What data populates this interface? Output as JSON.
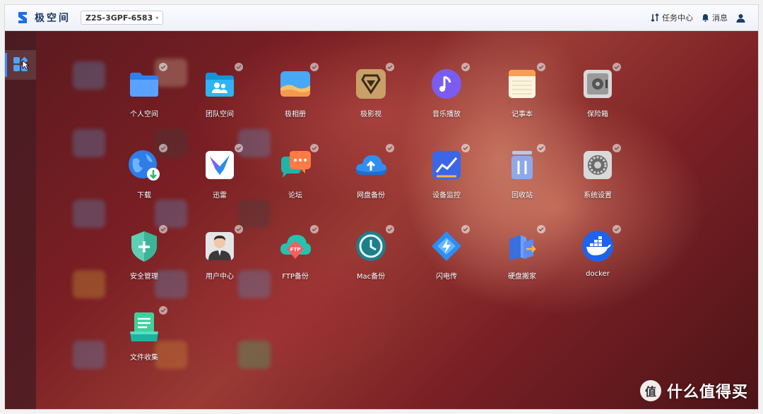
{
  "topbar": {
    "brand": "极空间",
    "device_name": "Z2S-3GPF-6583",
    "task_center": "任务中心",
    "messages": "消息",
    "icons": {
      "task": "task-center-icon",
      "bell": "bell-icon",
      "user": "user-icon"
    }
  },
  "apps": [
    {
      "label": "个人空间",
      "icon": "folder-icon"
    },
    {
      "label": "团队空间",
      "icon": "team-folder-icon"
    },
    {
      "label": "极相册",
      "icon": "photo-album-icon"
    },
    {
      "label": "极影视",
      "icon": "video-icon"
    },
    {
      "label": "音乐播放",
      "icon": "music-icon"
    },
    {
      "label": "记事本",
      "icon": "notepad-icon"
    },
    {
      "label": "保险箱",
      "icon": "safe-icon"
    },
    {
      "label": "下载",
      "icon": "download-globe-icon"
    },
    {
      "label": "迅雷",
      "icon": "thunder-icon"
    },
    {
      "label": "论坛",
      "icon": "forum-icon"
    },
    {
      "label": "网盘备份",
      "icon": "cloud-backup-icon"
    },
    {
      "label": "设备监控",
      "icon": "monitor-chart-icon"
    },
    {
      "label": "回收站",
      "icon": "trash-icon"
    },
    {
      "label": "系统设置",
      "icon": "settings-icon"
    },
    {
      "label": "安全管理",
      "icon": "shield-icon"
    },
    {
      "label": "用户中心",
      "icon": "user-center-icon"
    },
    {
      "label": "FTP备份",
      "icon": "ftp-icon"
    },
    {
      "label": "Mac备份",
      "icon": "time-machine-icon"
    },
    {
      "label": "闪电传",
      "icon": "lightning-icon"
    },
    {
      "label": "硬盘搬家",
      "icon": "disk-migrate-icon"
    },
    {
      "label": "docker",
      "icon": "docker-icon"
    },
    {
      "label": "文件收集",
      "icon": "file-collect-icon"
    }
  ],
  "watermark": {
    "symbol": "值",
    "text": "什么值得买"
  }
}
